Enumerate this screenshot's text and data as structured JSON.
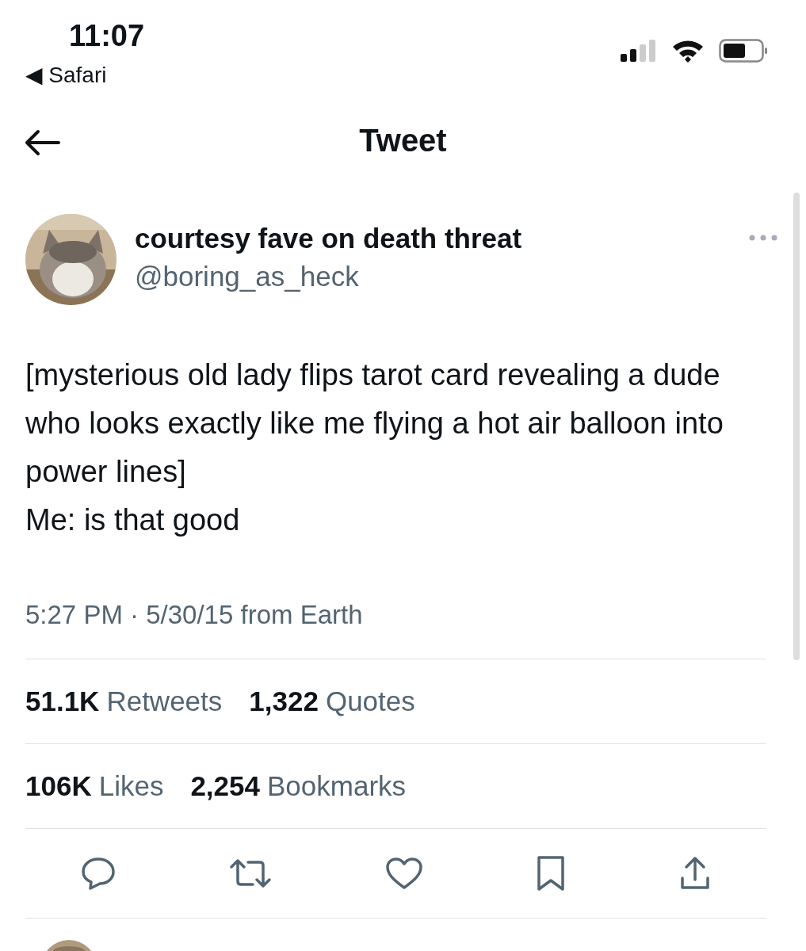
{
  "status_bar": {
    "time": "11:07",
    "back_app": "◀ Safari"
  },
  "header": {
    "title": "Tweet"
  },
  "tweet": {
    "author": {
      "name": "courtesy fave on death threat",
      "handle": "@boring_as_heck"
    },
    "text": [
      "[mysterious old lady flips tarot card revealing a dude who looks exactly like me flying a hot air balloon into power lines]",
      "Me: is that good"
    ],
    "meta": "5:27 PM · 5/30/15 from Earth",
    "stats_rows": [
      [
        {
          "count": "51.1K",
          "metric": "Retweets"
        },
        {
          "count": "1,322",
          "metric": "Quotes"
        }
      ],
      [
        {
          "count": "106K",
          "metric": "Likes"
        },
        {
          "count": "2,254",
          "metric": "Bookmarks"
        }
      ]
    ],
    "actions": [
      {
        "kind": "reply"
      },
      {
        "kind": "retweet"
      },
      {
        "kind": "like"
      },
      {
        "kind": "bookmark"
      },
      {
        "kind": "share"
      }
    ]
  }
}
